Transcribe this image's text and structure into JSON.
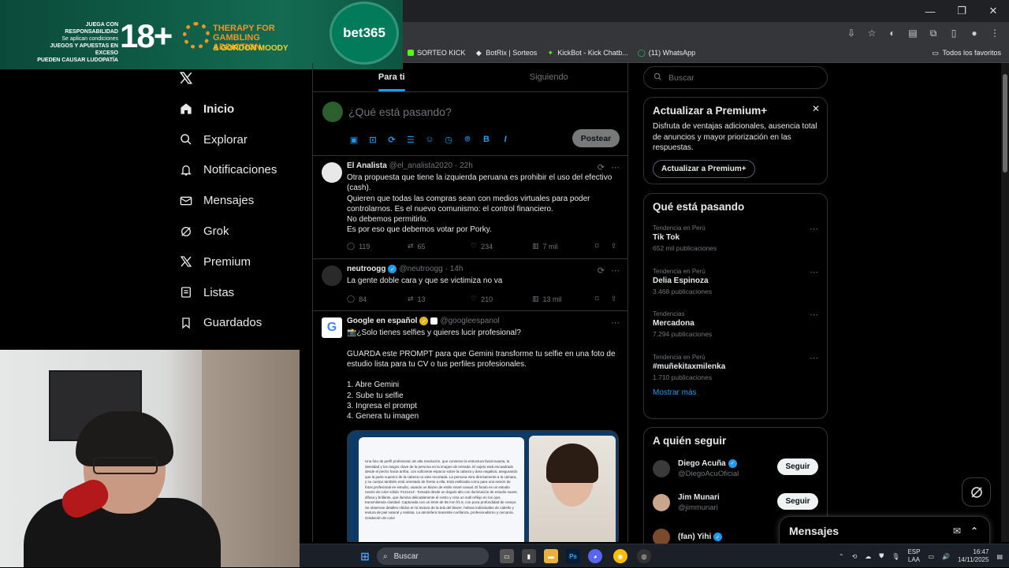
{
  "banner": {
    "responsible_line1": "JUEGA CON RESPONSABILIDAD",
    "responsible_line2": "Se aplican condiciones",
    "responsible_line3": "JUEGOS Y APUESTAS EN EXCESO",
    "responsible_line4": "PUEDEN CAUSAR LUDOPATÍA",
    "age": "18+",
    "therapy": "THERAPY FOR GAMBLING ADDICTION",
    "gordon": "& GORDON MOODY",
    "brand": "bet365"
  },
  "bookmarks": [
    {
      "label": "SORTEO KICK",
      "icon": "kick-icon"
    },
    {
      "label": "BotRix | Sorteos",
      "icon": "botrix-icon"
    },
    {
      "label": "KickBot - Kick Chatb...",
      "icon": "kickbot-icon"
    },
    {
      "label": "(11) WhatsApp",
      "icon": "whatsapp-icon"
    }
  ],
  "bookmarks_all": "Todos los favoritos",
  "nav": {
    "items": [
      {
        "label": "Inicio",
        "icon": "home-icon",
        "active": true
      },
      {
        "label": "Explorar",
        "icon": "search-icon"
      },
      {
        "label": "Notificaciones",
        "icon": "bell-icon"
      },
      {
        "label": "Mensajes",
        "icon": "mail-icon"
      },
      {
        "label": "Grok",
        "icon": "grok-icon"
      },
      {
        "label": "Premium",
        "icon": "x-icon"
      },
      {
        "label": "Listas",
        "icon": "list-icon"
      },
      {
        "label": "Guardados",
        "icon": "bookmark-icon"
      }
    ]
  },
  "tabs": {
    "for_you": "Para ti",
    "following": "Siguiendo"
  },
  "composer": {
    "placeholder": "¿Qué está pasando?",
    "post_label": "Postear"
  },
  "tweets": [
    {
      "name": "El Analista",
      "handle": "@el_analista2020",
      "time": "· 22h",
      "text": "Otra propuesta que tiene la izquierda peruana es prohibir el uso del efectivo (cash).\nQuieren que todas las compras sean con medios virtuales para poder controlarnos. Es el nuevo comunismo: el control financiero.\nNo debemos permitirlo.\nEs por eso que debemos votar por Porky.",
      "replies": "119",
      "reposts": "65",
      "likes": "234",
      "views": "7 mil"
    },
    {
      "name": "neutroogg",
      "handle": "@neutroogg",
      "time": "· 14h",
      "text": "La gente doble cara y que se victimiza no va",
      "replies": "84",
      "reposts": "13",
      "likes": "210",
      "views": "13 mil"
    },
    {
      "name": "Google en español",
      "handle": "@googleespanol",
      "time": "",
      "text": "📸¿Solo tienes selfies y quieres lucir profesional?\n\nGUARDA este PROMPT para que Gemini transforme tu selfie en una foto de estudio lista para tu CV o tus perfiles profesionales.\n\n1. Abre Gemini\n2. Sube tu selfie\n3. Ingresa el prompt\n4. Genera tu imagen",
      "media_text": "Una foto de perfil profesional, de alta resolución, que conserve la estructura facial exacta, la identidad y los rasgos clave de la persona en la imagen de entrada. El sujeto está encuadrado desde el pecho hacia arriba, con suficiente espacio sobre la cabeza y área negativa, asegurando que la parte superior de la cabeza no este recortada. La persona mira directamente a la cámara, y su cuerpo también está orientado de frente a ella. Está estilizada como para una sesión de fotos profesional en estudio, usando un blazer de estilo smart casual. El fondo es un estudio neutro de color sólido '#141414'. Tomada desde un ángulo alto con iluminación de estudio suave, difusa y brillante, que ilumina delicadamente el rostro y crea un sutil reflejo en los ojos, transmitiendo claridad. Capturada con un lente de 85 mm f/1.8, con poca profundidad de campo. Se observan detalles nítidos en la textura de la tela del blazer, hebras individuales de cabello y textura de piel natural y realista. La atmósfera transmite confianza, profesionalismo y cercanía. Gradación de color"
    }
  ],
  "search": {
    "placeholder": "Buscar"
  },
  "premium": {
    "title": "Actualizar a Premium+",
    "text": "Disfruta de ventajas adicionales, ausencia total de anuncios y mayor priorización en las respuestas.",
    "button": "Actualizar a Premium+"
  },
  "trends": {
    "title": "Qué está pasando",
    "items": [
      {
        "context": "Tendencia en Perú",
        "name": "Tik Tok",
        "count": "652 mil publicaciones"
      },
      {
        "context": "Tendencia en Perú",
        "name": "Delia Espinoza",
        "count": "3.468 publicaciones"
      },
      {
        "context": "Tendencias",
        "name": "Mercadona",
        "count": "7.294 publicaciones"
      },
      {
        "context": "Tendencia en Perú",
        "name": "#muñekitaxmilenka",
        "count": "1.710 publicaciones"
      }
    ],
    "show_more": "Mostrar más"
  },
  "follow": {
    "title": "A quién seguir",
    "items": [
      {
        "name": "Diego Acuña",
        "handle": "@DiegoAcuOficial",
        "button": "Seguir"
      },
      {
        "name": "Jim Munari",
        "handle": "@jimmunari",
        "button": "Seguir"
      },
      {
        "name": "(fan) Yihi",
        "handle": "",
        "button": ""
      }
    ]
  },
  "messages_drawer": {
    "title": "Mensajes"
  },
  "taskbar": {
    "search": "Buscar",
    "lang1": "ESP",
    "lang2": "LAA",
    "time": "16:47",
    "date": "14/11/2025"
  }
}
